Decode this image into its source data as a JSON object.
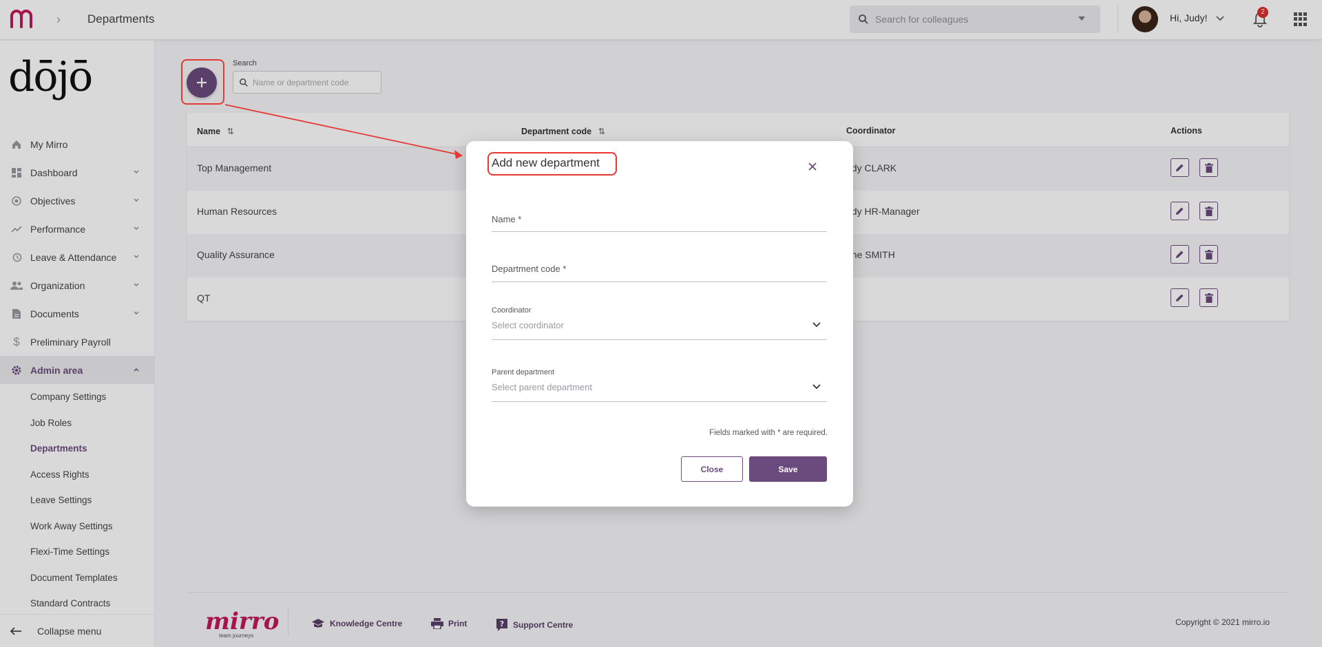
{
  "topbar": {
    "page_title": "Departments",
    "search_placeholder": "Search for colleagues",
    "greeting": "Hi, Judy!",
    "notification_count": "2"
  },
  "sidebar": {
    "brand": "dōjō",
    "items": [
      {
        "label": "My Mirro",
        "icon": "home-icon"
      },
      {
        "label": "Dashboard",
        "icon": "dashboard-icon"
      },
      {
        "label": "Objectives",
        "icon": "target-icon"
      },
      {
        "label": "Performance",
        "icon": "trending-up-icon"
      },
      {
        "label": "Leave & Attendance",
        "icon": "history-icon"
      },
      {
        "label": "Organization",
        "icon": "people-icon"
      },
      {
        "label": "Documents",
        "icon": "document-icon"
      },
      {
        "label": "Preliminary Payroll",
        "icon": "dollar-icon"
      },
      {
        "label": "Admin area",
        "icon": "gear-icon"
      }
    ],
    "sub_items": [
      "Company Settings",
      "Job Roles",
      "Departments",
      "Access Rights",
      "Leave Settings",
      "Work Away Settings",
      "Flexi-Time Settings",
      "Document Templates",
      "Standard Contracts"
    ],
    "collapse_label": "Collapse menu"
  },
  "main": {
    "search_label": "Search",
    "search_placeholder": "Name or department code",
    "columns": [
      "Name",
      "Department code",
      "Coordinator",
      "Actions"
    ],
    "rows": [
      {
        "name": "Top Management",
        "code": "",
        "coordinator": "ndy CLARK"
      },
      {
        "name": "Human Resources",
        "code": "",
        "coordinator": "udy HR-Manager"
      },
      {
        "name": "Quality Assurance",
        "code": "",
        "coordinator": "ane SMITH"
      },
      {
        "name": "QT",
        "code": "",
        "coordinator": ""
      }
    ]
  },
  "footer": {
    "logo": "mirro",
    "tagline": "team journeys",
    "links": [
      "Knowledge Centre",
      "Print",
      "Support Centre"
    ],
    "copyright": "Copyright © 2021 mirro.io"
  },
  "dialog": {
    "title": "Add new department",
    "name_label": "Name *",
    "code_label": "Department code *",
    "coordinator_label": "Coordinator",
    "coordinator_placeholder": "Select coordinator",
    "parent_label": "Parent department",
    "parent_placeholder": "Select parent department",
    "required_note": "Fields marked with * are required.",
    "close_label": "Close",
    "save_label": "Save"
  },
  "colors": {
    "accent": "#6b4b7e",
    "annotation": "#e53935",
    "brand_pink": "#c2185b"
  }
}
